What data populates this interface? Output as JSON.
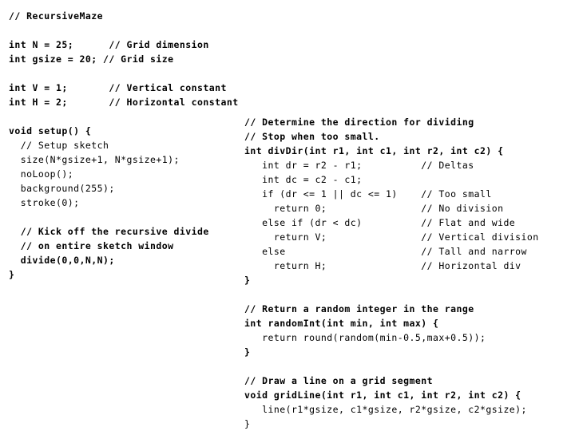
{
  "document": {
    "kind": "source-code-listing",
    "language": "Processing",
    "sketch_name": "RecursiveMaze",
    "background_color": "#ffffff",
    "text_color": "#000000",
    "columns": 2
  },
  "left_column": {
    "name": "left-code-block",
    "lines": [
      {
        "text": "// RecursiveMaze",
        "weight": "bold"
      },
      {
        "text": "",
        "weight": "regular"
      },
      {
        "text": "int N = 25;      // Grid dimension",
        "weight": "bold"
      },
      {
        "text": "int gsize = 20; // Grid size",
        "weight": "bold"
      },
      {
        "text": "",
        "weight": "regular"
      },
      {
        "text": "int V = 1;       // Vertical constant",
        "weight": "bold"
      },
      {
        "text": "int H = 2;       // Horizontal constant",
        "weight": "bold"
      },
      {
        "text": "",
        "weight": "regular"
      },
      {
        "text": "void setup() {",
        "weight": "bold"
      },
      {
        "text": "  // Setup sketch",
        "weight": "regular"
      },
      {
        "text": "  size(N*gsize+1, N*gsize+1);",
        "weight": "regular"
      },
      {
        "text": "  noLoop();",
        "weight": "regular"
      },
      {
        "text": "  background(255);",
        "weight": "regular"
      },
      {
        "text": "  stroke(0);",
        "weight": "regular"
      },
      {
        "text": "",
        "weight": "regular"
      },
      {
        "text": "  // Kick off the recursive divide",
        "weight": "bold"
      },
      {
        "text": "  // on entire sketch window",
        "weight": "bold"
      },
      {
        "text": "  divide(0,0,N,N);",
        "weight": "bold"
      },
      {
        "text": "}",
        "weight": "bold"
      }
    ]
  },
  "right_column": {
    "name": "right-code-block",
    "lines": [
      {
        "text": "// Determine the direction for dividing",
        "weight": "bold"
      },
      {
        "text": "// Stop when too small.",
        "weight": "bold"
      },
      {
        "text": "int divDir(int r1, int c1, int r2, int c2) {",
        "weight": "bold"
      },
      {
        "text": "   int dr = r2 - r1;          // Deltas",
        "weight": "regular"
      },
      {
        "text": "   int dc = c2 - c1;",
        "weight": "regular"
      },
      {
        "text": "   if (dr <= 1 || dc <= 1)    // Too small",
        "weight": "regular"
      },
      {
        "text": "     return 0;                // No division",
        "weight": "regular"
      },
      {
        "text": "   else if (dr < dc)          // Flat and wide",
        "weight": "regular"
      },
      {
        "text": "     return V;                // Vertical division",
        "weight": "regular"
      },
      {
        "text": "   else                       // Tall and narrow",
        "weight": "regular"
      },
      {
        "text": "     return H;                // Horizontal div",
        "weight": "regular"
      },
      {
        "text": "}",
        "weight": "bold"
      },
      {
        "text": "",
        "weight": "regular"
      },
      {
        "text": "// Return a random integer in the range",
        "weight": "bold"
      },
      {
        "text": "int randomInt(int min, int max) {",
        "weight": "bold"
      },
      {
        "text": "   return round(random(min-0.5,max+0.5));",
        "weight": "regular"
      },
      {
        "text": "}",
        "weight": "bold"
      },
      {
        "text": "",
        "weight": "regular"
      },
      {
        "text": "// Draw a line on a grid segment",
        "weight": "bold"
      },
      {
        "text": "void gridLine(int r1, int c1, int r2, int c2) {",
        "weight": "bold"
      },
      {
        "text": "   line(r1*gsize, c1*gsize, r2*gsize, c2*gsize);",
        "weight": "regular"
      },
      {
        "text": "}",
        "weight": "regular"
      }
    ]
  }
}
